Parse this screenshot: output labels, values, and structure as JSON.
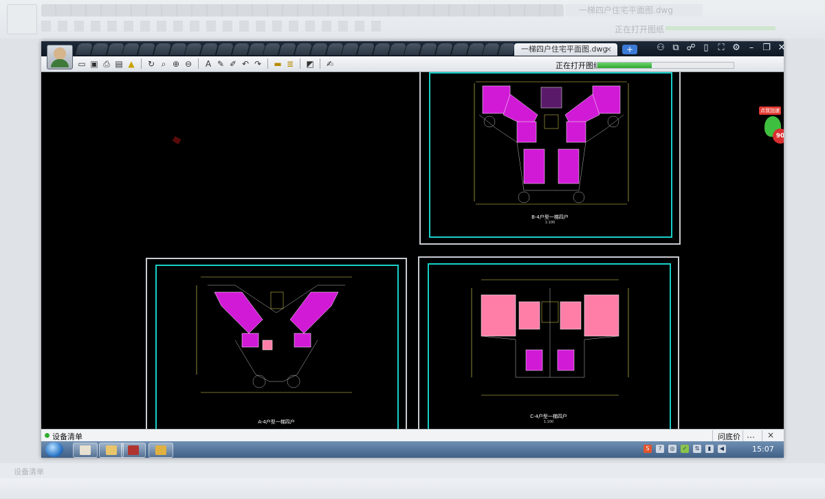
{
  "app": {
    "file_tab": "一梯四户住宅平面图.dwg",
    "file_tab_close": "×",
    "new_tab": "+",
    "status_text": "正在打开图纸",
    "progress_fraction": 0.4
  },
  "window_controls": [
    "users-icon",
    "share-icon",
    "chat-icon",
    "phone-icon",
    "fullscreen-icon",
    "settings-icon",
    "minimize-icon",
    "restore-icon",
    "close-icon"
  ],
  "toolbar": {
    "tools": [
      "open-icon",
      "save-icon",
      "print-icon",
      "export-pdf-icon",
      "lock-icon",
      "rotate-icon",
      "zoom-window-icon",
      "zoom-in-icon",
      "zoom-out-icon",
      "text-icon",
      "pen-icon",
      "pencil-icon",
      "undo-icon",
      "redo-icon",
      "measure-icon",
      "measure-area-icon",
      "layers-icon",
      "edit-doc-icon"
    ]
  },
  "drawing": {
    "sheets": [
      {
        "title": "B-4户型一梯四户",
        "scale": "1:100"
      },
      {
        "title": "A-4户型一梯四户",
        "scale": ""
      },
      {
        "title": "C-4户型一梯四户",
        "scale": "1:100"
      }
    ]
  },
  "addon": {
    "label": "点我加速",
    "value": "90"
  },
  "statusbar": {
    "device_list": "设备清单",
    "price_inquiry": "问底价",
    "chat": "…",
    "close": "×"
  },
  "taskbar": {
    "clock": "15:07"
  },
  "background_ghost": {
    "status_text": "正在打开图纸",
    "file_tab": "一梯四户住宅平面图.dwg",
    "device_list": "设备清单"
  },
  "colors": {
    "canvas": "#000000",
    "sheet_border": "#19d0c8",
    "plan_magenta": "#e020e0",
    "plan_pink": "#ff7ea8",
    "progress": "#2ea82e"
  }
}
